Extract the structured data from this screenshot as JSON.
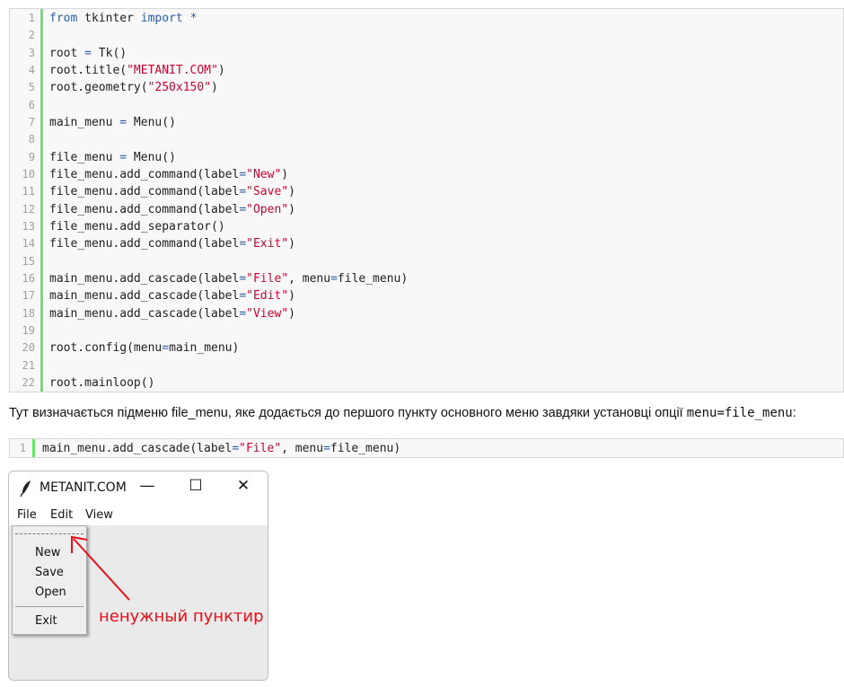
{
  "code_main": {
    "lines": [
      {
        "n": "1",
        "html": "<span class=\"kw\">from</span> tkinter <span class=\"kw\">import</span> <span class=\"op\">*</span>"
      },
      {
        "n": "2",
        "html": ""
      },
      {
        "n": "3",
        "html": "root <span class=\"op\">=</span> Tk()"
      },
      {
        "n": "4",
        "html": "root.title(<span class=\"str\">\"METANIT.COM\"</span>)"
      },
      {
        "n": "5",
        "html": "root.geometry(<span class=\"str\">\"250x150\"</span>)"
      },
      {
        "n": "6",
        "html": ""
      },
      {
        "n": "7",
        "html": "main_menu <span class=\"op\">=</span> Menu()"
      },
      {
        "n": "8",
        "html": ""
      },
      {
        "n": "9",
        "html": "file_menu <span class=\"op\">=</span> Menu()"
      },
      {
        "n": "10",
        "html": "file_menu.add_command(label<span class=\"op\">=</span><span class=\"str\">\"New\"</span>)"
      },
      {
        "n": "11",
        "html": "file_menu.add_command(label<span class=\"op\">=</span><span class=\"str\">\"Save\"</span>)"
      },
      {
        "n": "12",
        "html": "file_menu.add_command(label<span class=\"op\">=</span><span class=\"str\">\"Open\"</span>)"
      },
      {
        "n": "13",
        "html": "file_menu.add_separator()"
      },
      {
        "n": "14",
        "html": "file_menu.add_command(label<span class=\"op\">=</span><span class=\"str\">\"Exit\"</span>)"
      },
      {
        "n": "15",
        "html": ""
      },
      {
        "n": "16",
        "html": "main_menu.add_cascade(label<span class=\"op\">=</span><span class=\"str\">\"File\"</span>, menu<span class=\"op\">=</span>file_menu)"
      },
      {
        "n": "17",
        "html": "main_menu.add_cascade(label<span class=\"op\">=</span><span class=\"str\">\"Edit\"</span>)"
      },
      {
        "n": "18",
        "html": "main_menu.add_cascade(label<span class=\"op\">=</span><span class=\"str\">\"View\"</span>)"
      },
      {
        "n": "19",
        "html": ""
      },
      {
        "n": "20",
        "html": "root.config(menu<span class=\"op\">=</span>main_menu)"
      },
      {
        "n": "21",
        "html": ""
      },
      {
        "n": "22",
        "html": "root.mainloop()"
      }
    ]
  },
  "paragraph": {
    "text_before": "Тут визначається підменю file_menu, яке додається до першого пункту основного меню завдяки установці опції ",
    "code": "menu=file_menu",
    "text_after": ":"
  },
  "code_snippet": {
    "lines": [
      {
        "n": "1",
        "html": "main_menu.add_cascade(label<span class=\"op\">=</span><span class=\"str\">\"File\"</span>, menu<span class=\"op\">=</span>file_menu)"
      }
    ]
  },
  "tk_window": {
    "title": "METANIT.COM",
    "minimize": "—",
    "maximize": "☐",
    "close": "✕",
    "menubar": [
      "File",
      "Edit",
      "View"
    ],
    "dropdown": [
      "New",
      "Save",
      "Open",
      "Exit"
    ],
    "feather_icon": "feather-icon"
  },
  "annotation": {
    "text": "ненужный пунктир",
    "color": "#e8101a"
  },
  "colors": {
    "gutter_accent": "#6ce26c",
    "keyword": "#2d5fa8",
    "string": "#d1002f"
  }
}
